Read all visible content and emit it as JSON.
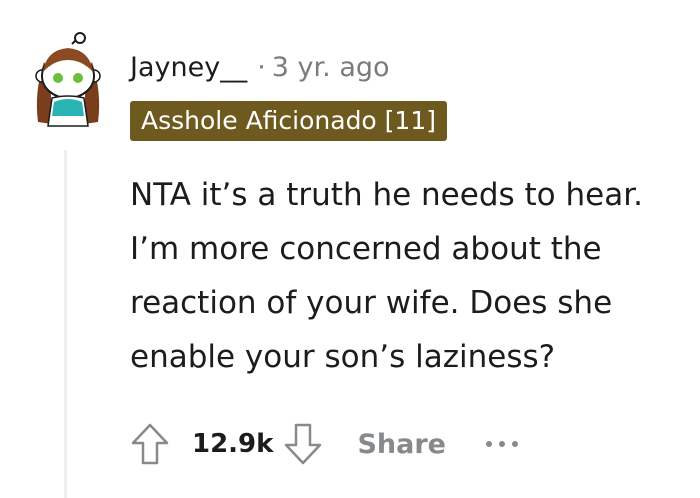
{
  "comment": {
    "author": "Jayney__",
    "separator": "·",
    "age": "3 yr. ago",
    "flair": "Asshole Aficionado [11]",
    "body_lines": [
      "NTA it’s a truth he needs to hear.",
      "I’m more concerned about the",
      "reaction of your wife. Does she",
      "enable your son’s laziness?"
    ],
    "score": "12.9k",
    "share_label": "Share",
    "more_label": "..."
  },
  "icons": {
    "upvote": "upvote-arrow-icon",
    "downvote": "downvote-arrow-icon",
    "more": "more-options-icon",
    "avatar": "snoo-avatar"
  },
  "colors": {
    "flair_bg": "#6e5a1e",
    "muted": "#7c7c7c",
    "action_gray": "#878a8c",
    "thread_line": "#edeff1"
  }
}
